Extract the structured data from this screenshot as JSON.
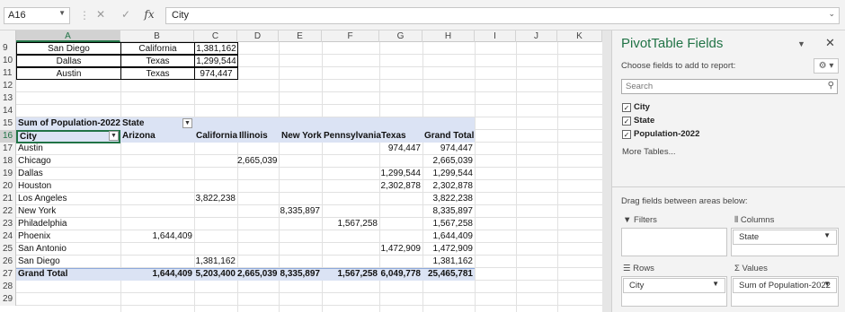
{
  "formula_bar": {
    "name_box": "A16",
    "cancel_icon": "✕",
    "enter_icon": "✓",
    "fx_label": "fx",
    "formula": "City"
  },
  "columns": [
    "A",
    "B",
    "C",
    "D",
    "E",
    "F",
    "G",
    "H",
    "I",
    "J",
    "K"
  ],
  "rows": {
    "r9": {
      "num": "9",
      "a": "San Diego",
      "b": "California",
      "c": "1,381,162"
    },
    "r10": {
      "num": "10",
      "a": "Dallas",
      "b": "Texas",
      "c": "1,299,544"
    },
    "r11": {
      "num": "11",
      "a": "Austin",
      "b": "Texas",
      "c": "974,447"
    },
    "r12": {
      "num": "12"
    },
    "r13": {
      "num": "13"
    },
    "r14": {
      "num": "14"
    },
    "r15": {
      "num": "15",
      "a": "Sum of Population-2022",
      "b": "State"
    },
    "r16": {
      "num": "16",
      "a": "City",
      "b": "Arizona",
      "c": "California",
      "d": "Illinois",
      "e": "New York",
      "f": "Pennsylvania",
      "g": "Texas",
      "h": "Grand Total"
    },
    "r17": {
      "num": "17",
      "a": "Austin",
      "g": "974,447",
      "h": "974,447"
    },
    "r18": {
      "num": "18",
      "a": "Chicago",
      "d": "2,665,039",
      "h": "2,665,039"
    },
    "r19": {
      "num": "19",
      "a": "Dallas",
      "g": "1,299,544",
      "h": "1,299,544"
    },
    "r20": {
      "num": "20",
      "a": "Houston",
      "g": "2,302,878",
      "h": "2,302,878"
    },
    "r21": {
      "num": "21",
      "a": "Los Angeles",
      "c": "3,822,238",
      "h": "3,822,238"
    },
    "r22": {
      "num": "22",
      "a": "New York",
      "e": "8,335,897",
      "h": "8,335,897"
    },
    "r23": {
      "num": "23",
      "a": "Philadelphia",
      "f": "1,567,258",
      "h": "1,567,258"
    },
    "r24": {
      "num": "24",
      "a": "Phoenix",
      "b": "1,644,409",
      "h": "1,644,409"
    },
    "r25": {
      "num": "25",
      "a": "San Antonio",
      "g": "1,472,909",
      "h": "1,472,909"
    },
    "r26": {
      "num": "26",
      "a": "San Diego",
      "c": "1,381,162",
      "h": "1,381,162"
    },
    "r27": {
      "num": "27",
      "a": "Grand Total",
      "b": "1,644,409",
      "c": "5,203,400",
      "d": "2,665,039",
      "e": "8,335,897",
      "f": "1,567,258",
      "g": "6,049,778",
      "h": "25,465,781"
    },
    "r28": {
      "num": "28"
    },
    "r29": {
      "num": "29"
    }
  },
  "pane": {
    "title": "PivotTable Fields",
    "subtitle": "Choose fields to add to report:",
    "search_placeholder": "Search",
    "fields": [
      "City",
      "State",
      "Population-2022"
    ],
    "more_tables": "More Tables...",
    "drag_hint": "Drag fields between areas below:",
    "filters_label": "Filters",
    "columns_label": "Columns",
    "rows_label": "Rows",
    "values_label": "Values",
    "columns_chip": "State",
    "rows_chip": "City",
    "values_chip": "Sum of Population-2022"
  }
}
